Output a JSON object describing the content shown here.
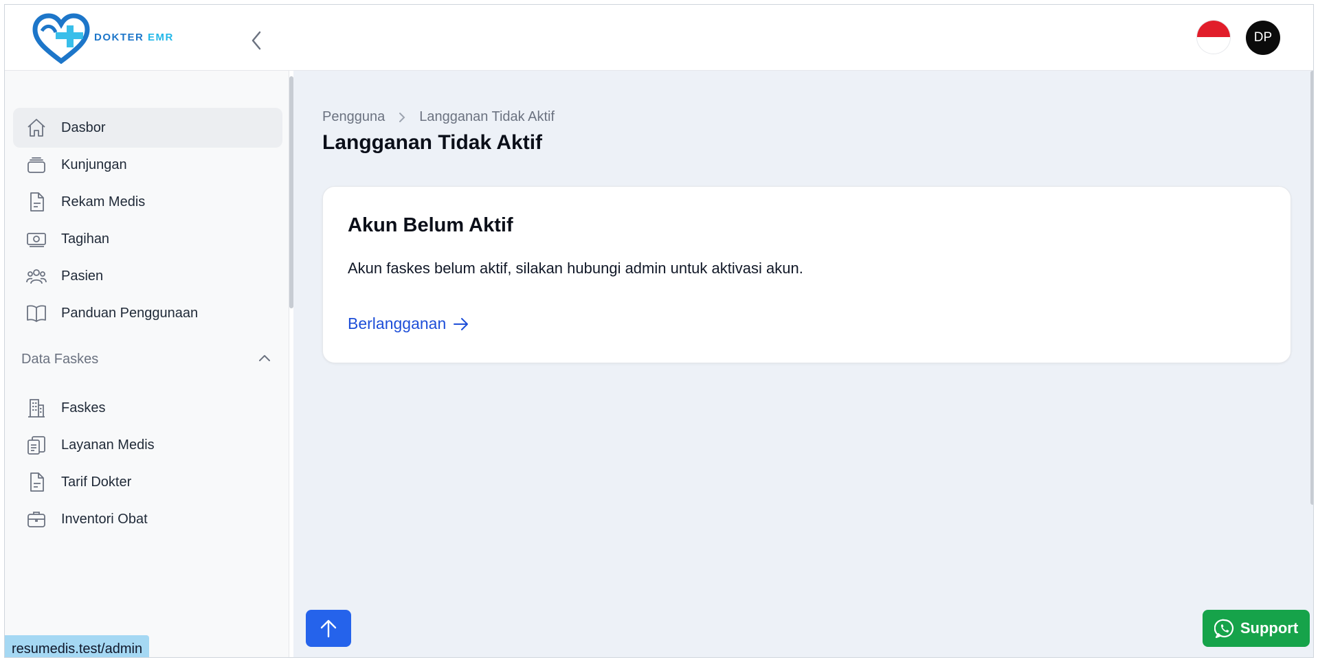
{
  "header": {
    "brand_main": "DOKTER",
    "brand_accent": "EMR",
    "avatar_initials": "DP"
  },
  "sidebar": {
    "items": [
      {
        "label": "Dasbor",
        "icon": "home-icon"
      },
      {
        "label": "Kunjungan",
        "icon": "stack-icon"
      },
      {
        "label": "Rekam Medis",
        "icon": "document-icon"
      },
      {
        "label": "Tagihan",
        "icon": "cash-icon"
      },
      {
        "label": "Pasien",
        "icon": "users-icon"
      },
      {
        "label": "Panduan Penggunaan",
        "icon": "book-icon"
      }
    ],
    "section_title": "Data Faskes",
    "section_items": [
      {
        "label": "Faskes",
        "icon": "building-icon"
      },
      {
        "label": "Layanan Medis",
        "icon": "clipboard-icon"
      },
      {
        "label": "Tarif Dokter",
        "icon": "document-icon"
      },
      {
        "label": "Inventori Obat",
        "icon": "briefcase-icon"
      }
    ]
  },
  "status_bar": {
    "url": "resumedis.test/admin"
  },
  "main": {
    "breadcrumb": [
      "Pengguna",
      "Langganan Tidak Aktif"
    ],
    "title": "Langganan Tidak Aktif",
    "card": {
      "title": "Akun Belum Aktif",
      "text": "Akun faskes belum aktif, silakan hubungi admin untuk aktivasi akun.",
      "link": "Berlangganan"
    },
    "support_label": "Support"
  },
  "colors": {
    "primary": "#2563eb",
    "support": "#16a34a",
    "link": "#1d4ed8",
    "main_bg": "#edf1f7"
  }
}
